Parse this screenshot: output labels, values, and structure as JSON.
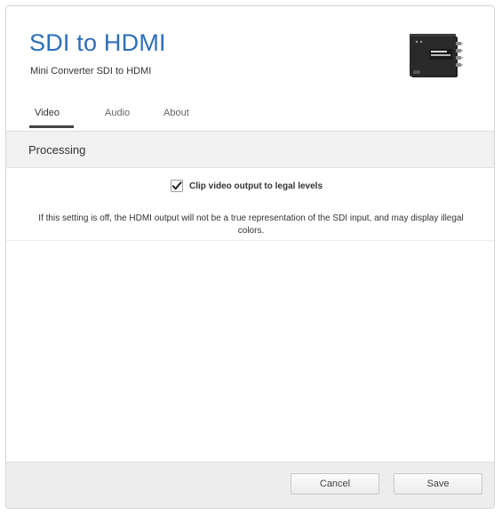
{
  "header": {
    "title": "SDI to HDMI",
    "subtitle": "Mini Converter SDI to HDMI"
  },
  "tabs": [
    {
      "label": "Video",
      "active": true
    },
    {
      "label": "Audio",
      "active": false
    },
    {
      "label": "About",
      "active": false
    }
  ],
  "section": {
    "title": "Processing"
  },
  "settings": {
    "clip_checkbox": {
      "label": "Clip video output to legal levels",
      "checked": true
    },
    "help_text": "If this setting is off, the HDMI output will not be a true representation of the SDI input, and may display illegal colors."
  },
  "footer": {
    "cancel_label": "Cancel",
    "save_label": "Save"
  },
  "colors": {
    "title": "#2d6fb8",
    "section_bg": "#f1f1f1",
    "footer_bg": "#ededed",
    "device_body": "#2a2a2a"
  },
  "icons": {
    "device": "converter-device-icon",
    "checkbox": "checkmark-icon"
  }
}
